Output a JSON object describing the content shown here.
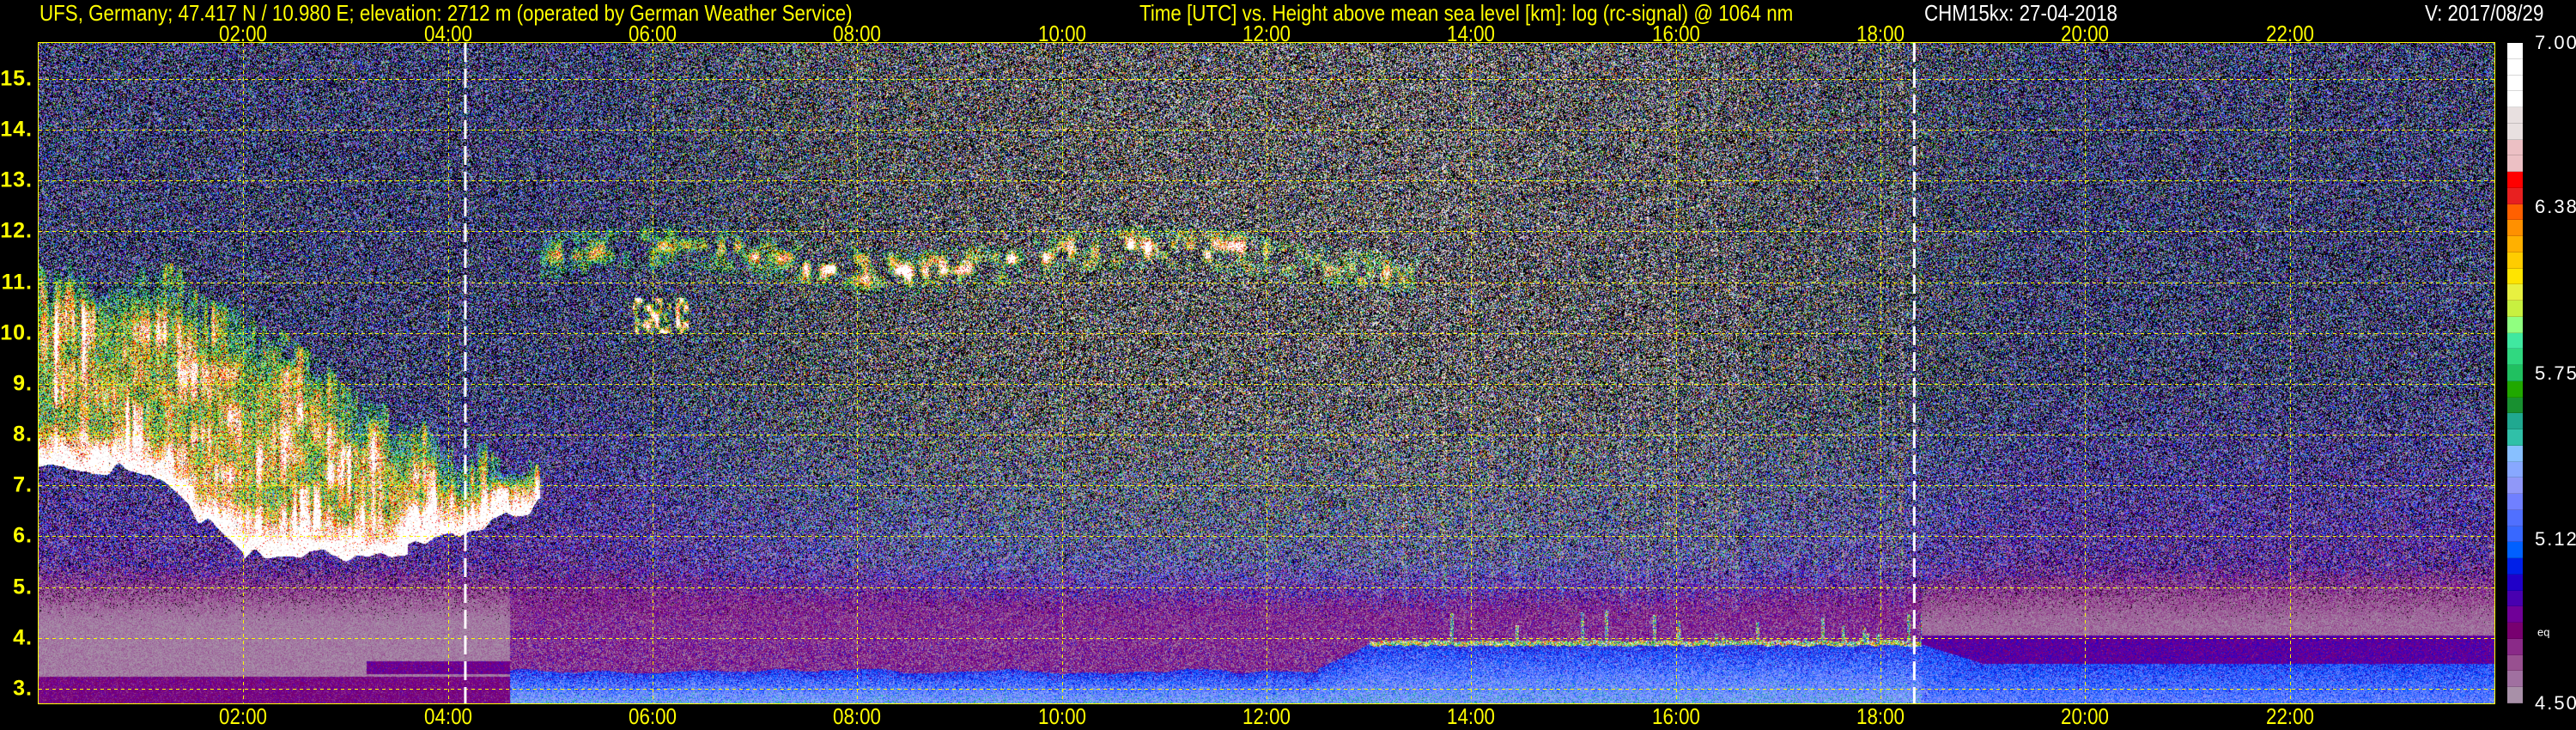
{
  "header": {
    "title_left": "UFS, Germany; 47.417 N / 10.980 E; elevation: 2712 m  (operated by German Weather Service)",
    "title_center": "Time [UTC] vs. Height above mean sea level [km]: log (rc-signal) @ 1064 nm",
    "instrument_date": "CHM15kx: 27-04-2018",
    "version": "V: 2017/08/29"
  },
  "chart_data": {
    "type": "heatmap",
    "title": "Time [UTC] vs. Height above mean sea level [km]: log (rc-signal) @ 1064 nm",
    "x_range": [
      0,
      24
    ],
    "x_ticks": [
      {
        "value": 2,
        "label": "02:00"
      },
      {
        "value": 4,
        "label": "04:00"
      },
      {
        "value": 6,
        "label": "06:00"
      },
      {
        "value": 8,
        "label": "08:00"
      },
      {
        "value": 10,
        "label": "10:00"
      },
      {
        "value": 12,
        "label": "12:00"
      },
      {
        "value": 14,
        "label": "14:00"
      },
      {
        "value": 16,
        "label": "16:00"
      },
      {
        "value": 18,
        "label": "18:00"
      },
      {
        "value": 20,
        "label": "20:00"
      },
      {
        "value": 22,
        "label": "22:00"
      }
    ],
    "y_range": [
      2.712,
      15.71
    ],
    "y_ticks": [
      {
        "value": 3,
        "label": "3."
      },
      {
        "value": 4,
        "label": "4."
      },
      {
        "value": 5,
        "label": "5."
      },
      {
        "value": 6,
        "label": "6."
      },
      {
        "value": 7,
        "label": "7."
      },
      {
        "value": 8,
        "label": "8."
      },
      {
        "value": 9,
        "label": "9."
      },
      {
        "value": 10,
        "label": "10."
      },
      {
        "value": 11,
        "label": "11."
      },
      {
        "value": 12,
        "label": "12."
      },
      {
        "value": 13,
        "label": "13."
      },
      {
        "value": 14,
        "label": "14."
      },
      {
        "value": 15,
        "label": "15."
      }
    ],
    "grid": true,
    "markers_time": [
      4.17,
      18.33
    ],
    "colorbar": {
      "range": [
        4.5,
        7.0
      ],
      "ticks": [
        {
          "value": 7.0,
          "label": "7.00"
        },
        {
          "value": 6.38,
          "label": "6.38"
        },
        {
          "value": 5.75,
          "label": "5.75"
        },
        {
          "value": 5.12,
          "label": "5.12"
        },
        {
          "value": 4.5,
          "label": "4.50"
        }
      ],
      "note": {
        "value": 4.77,
        "label": "eq"
      },
      "colors_top_to_bottom": [
        "#ffffff",
        "#ffffff",
        "#ffffff",
        "#ffffff",
        "#e8e0e0",
        "#e8e0e0",
        "#ecc0c4",
        "#ecc0c4",
        "#ff0000",
        "#e82020",
        "#ff6000",
        "#ff9000",
        "#ffb000",
        "#ffcc00",
        "#ffe400",
        "#e8f040",
        "#c8f040",
        "#90ff80",
        "#40e8a0",
        "#30d880",
        "#20c060",
        "#20a800",
        "#189030",
        "#20a890",
        "#30c0a8",
        "#88c0ff",
        "#88a8ff",
        "#9098f8",
        "#7080ff",
        "#5070ff",
        "#3868ff",
        "#0060ff",
        "#0020e8",
        "#2000c8",
        "#4800b0",
        "#700098",
        "#780070",
        "#8a2a88",
        "#985090",
        "#a070a0",
        "#a890a8"
      ]
    },
    "features": {
      "low_cloud": {
        "time": [
          0,
          4.9
        ],
        "height": [
          5.6,
          11.4
        ]
      },
      "cirrus": {
        "time": [
          5,
          13.5
        ],
        "height": [
          10.0,
          12.0
        ]
      },
      "boundary_layer_top_day": {
        "time": [
          13,
          18.33
        ],
        "height": 3.9
      },
      "residual_layer_night": {
        "time": [
          18.33,
          24
        ],
        "height": 4.0
      }
    }
  }
}
